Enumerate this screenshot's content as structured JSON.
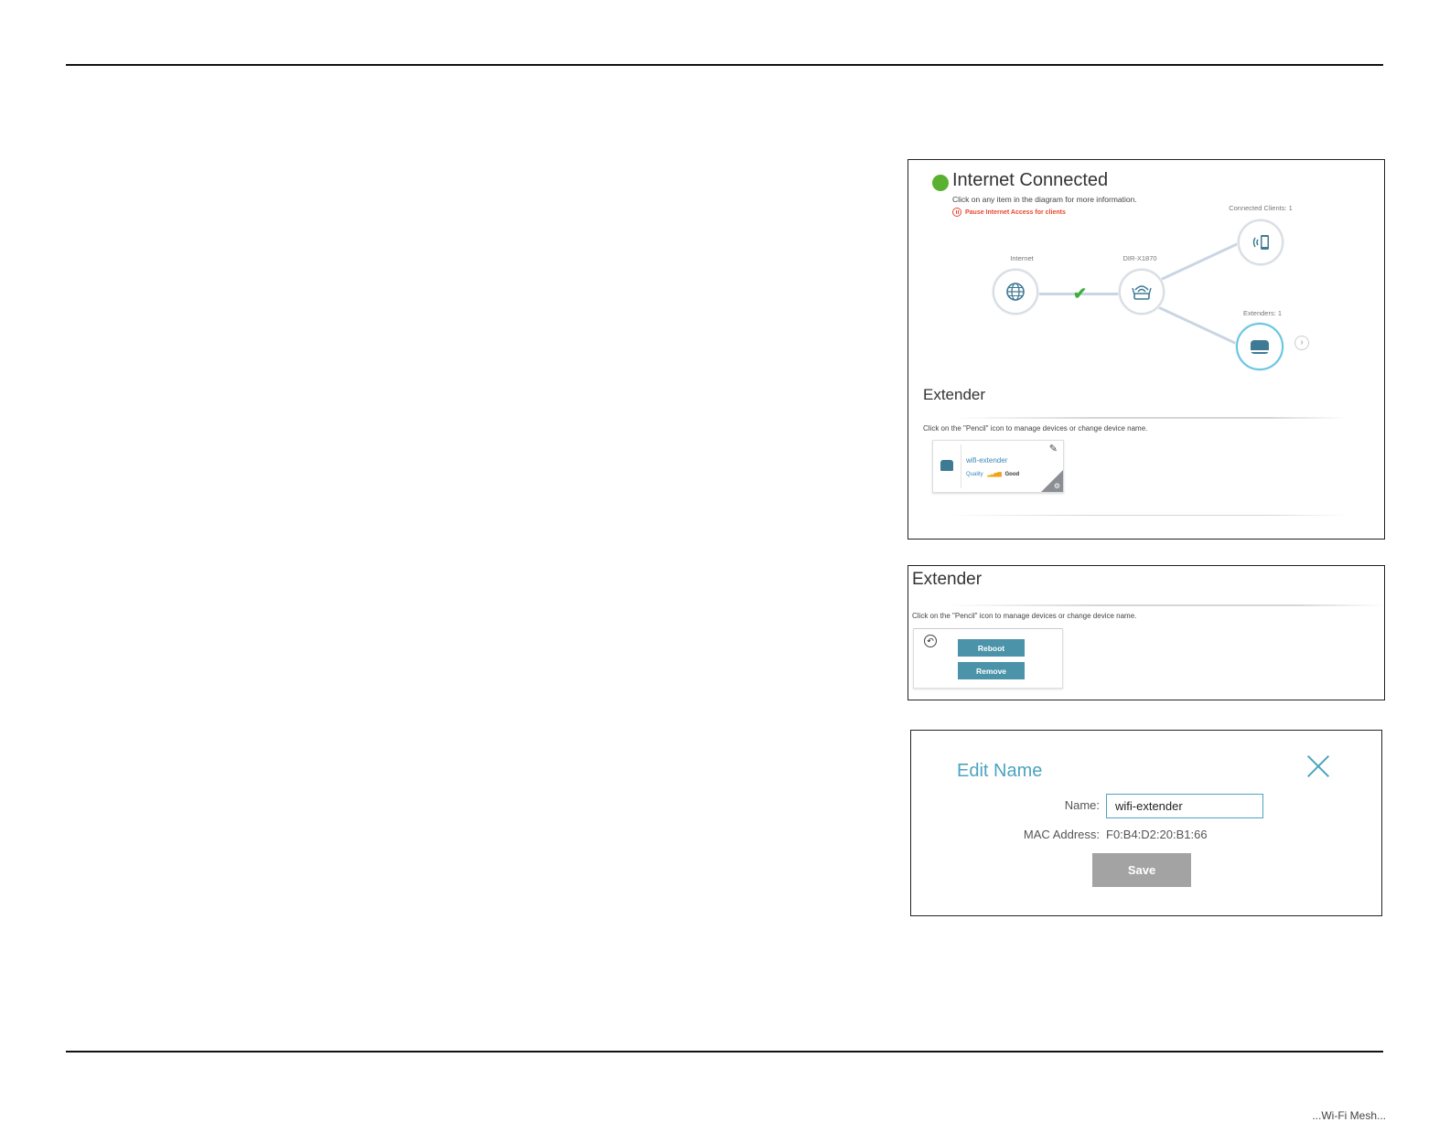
{
  "footer": {
    "text": "...Wi-Fi Mesh..."
  },
  "panel1": {
    "status": "Internet Connected",
    "hint": "Click on any item in the diagram for more information.",
    "pause_link": "Pause Internet Access for clients",
    "diagram": {
      "internet_label": "Internet",
      "router_label": "DIR-X1870",
      "clients_label": "Connected Clients: 1",
      "extenders_label": "Extenders: 1"
    },
    "section_title": "Extender",
    "section_hint": "Click on the \"Pencil\" icon to manage devices or change device name.",
    "card": {
      "name": "wifi-extender",
      "quality_label": "Quality",
      "quality_value": "Good",
      "quality_level": 4
    }
  },
  "panel2": {
    "section_title": "Extender",
    "section_hint": "Click on the \"Pencil\" icon to manage devices or change device name.",
    "reboot_label": "Reboot",
    "remove_label": "Remove"
  },
  "panel3": {
    "title": "Edit Name",
    "name_label": "Name:",
    "name_value": "wifi-extender",
    "mac_label": "MAC Address:",
    "mac_value": "F0:B4:D2:20:B1:66",
    "save_label": "Save"
  },
  "colors": {
    "accent": "#4da3c0",
    "status_green": "#5ab031",
    "alert_red": "#e8472f",
    "button_teal": "#4a93a9"
  }
}
